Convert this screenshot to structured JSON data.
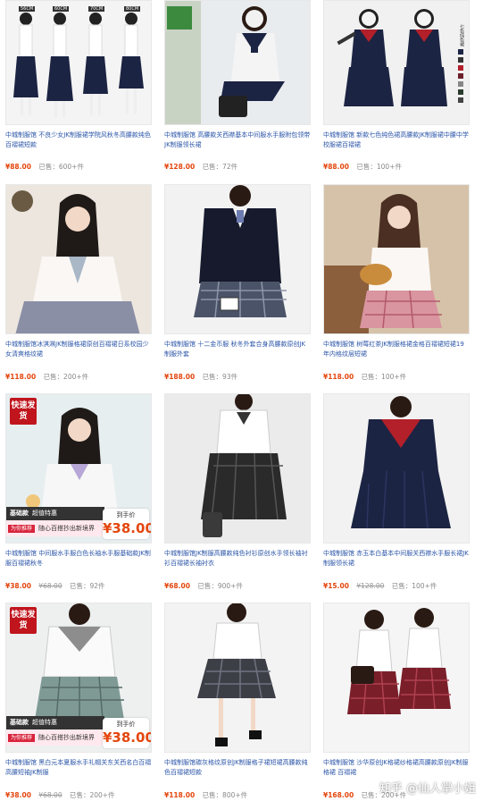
{
  "products": [
    {
      "title": "中城制服馆 不良少女JK制服裙学院风秋冬高腰款纯色百褶裙短款",
      "price": "¥88.00",
      "original": "",
      "sold": "已售：600+件"
    },
    {
      "title": "中城制服馆 高腰款关西襟基本中间服水手服附包领带JK制服领长裙",
      "price": "¥128.00",
      "original": "",
      "sold": "已售：72件"
    },
    {
      "title": "中城制服馆 新款七色纯色裙高腰款JK制服裙中腰中学校服裙百褶裙",
      "price": "¥88.00",
      "original": "",
      "sold": "已售：100+件"
    },
    {
      "title": "中城制服馆冰淇淋JK制服格裙原创百褶裙日系校园少女清爽格纹裙",
      "price": "¥118.00",
      "original": "",
      "sold": "已售：200+件"
    },
    {
      "title": "中城制服馆 十二金币服 秋冬外套合身高腰款原创JK制服外套",
      "price": "¥188.00",
      "original": "",
      "sold": "已售：93件"
    },
    {
      "title": "中城制服馆 树莓红茶JK制服格裙金格百褶裙短裙19年内格纹层短裙",
      "price": "¥118.00",
      "original": "",
      "sold": "已售：100+件"
    },
    {
      "title": "中城制服馆 中间服水手服白色长袖水手服基础款JK制服百褶裙秋冬",
      "price": "¥38.00",
      "original": "¥68.00",
      "sold": "已售：92件"
    },
    {
      "title": "中城制服馆JK制服高腰款纯色衬衫原创水手领长袖衬衫百褶裙长袖衬衣",
      "price": "¥68.00",
      "original": "",
      "sold": "已售：900+件"
    },
    {
      "title": "中城制服馆 赤玉本白基本中间服关西襟水手服长裙JK制服领长裙",
      "price": "¥15.00",
      "original": "¥128.00",
      "sold": "已售：100+件"
    },
    {
      "title": "中城制服馆 黑白元本夏服水手礼帽关东关西名白百褶高腰短袖JK制服",
      "price": "¥38.00",
      "original": "¥68.00",
      "sold": "已售：200+件"
    },
    {
      "title": "中城制服馆碳灰格纹原创JK制服格子裙短裙高腰款纯色百褶裙短款",
      "price": "¥118.00",
      "original": "",
      "sold": "已售：800+件"
    },
    {
      "title": "中城制服馆 沙华原创JK格裙纱格裙高腰款原创JK制服格裙 百褶裙",
      "price": "¥168.00",
      "original": "",
      "sold": "已售：200+件"
    }
  ],
  "badges": {
    "fast_ship": "快速发货",
    "size_labels": [
      "56CM",
      "60CM",
      "70CM",
      "80CM"
    ],
    "side_label": "七色纯色裙"
  },
  "promo": {
    "basic": "基础款",
    "deal": "超值特惠",
    "tag": "为你推荐",
    "desc": "随心百搭抄出新境界",
    "price_label": "到手价",
    "price": "¥38.00"
  },
  "watermark": "知乎 @仙人掌小姐",
  "colors": {
    "price": "#e4460e",
    "title": "#2b55a8",
    "navy": "#1c2443",
    "red": "#c0151d"
  }
}
